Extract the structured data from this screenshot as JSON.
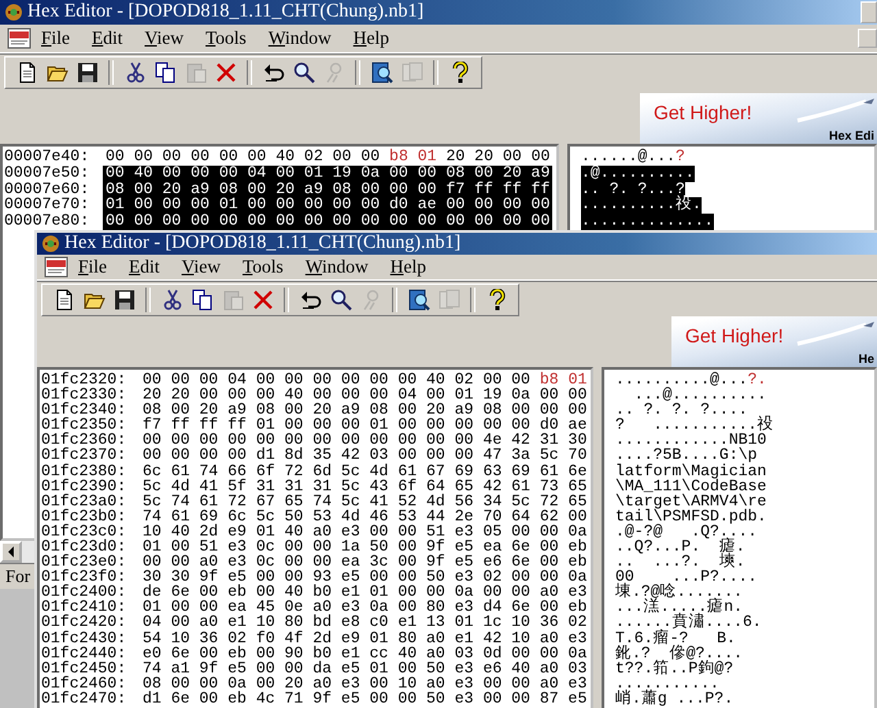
{
  "back_window": {
    "title": "Hex Editor - [DOPOD818_1.11_CHT(Chung).nb1]",
    "menu": [
      {
        "label": "File"
      },
      {
        "label": "Edit"
      },
      {
        "label": "View"
      },
      {
        "label": "Tools"
      },
      {
        "label": "Window"
      },
      {
        "label": "Help"
      }
    ],
    "toolbar": [
      {
        "kind": "new",
        "disabled": false
      },
      {
        "kind": "open",
        "disabled": false
      },
      {
        "kind": "save",
        "disabled": false
      },
      {
        "kind": "separator"
      },
      {
        "kind": "cut",
        "disabled": false
      },
      {
        "kind": "copy",
        "disabled": false
      },
      {
        "kind": "paste",
        "disabled": true
      },
      {
        "kind": "delete",
        "disabled": false
      },
      {
        "kind": "separator"
      },
      {
        "kind": "undo",
        "disabled": false
      },
      {
        "kind": "find",
        "disabled": false
      },
      {
        "kind": "replace",
        "disabled": true
      },
      {
        "kind": "separator"
      },
      {
        "kind": "find_doc",
        "disabled": false
      },
      {
        "kind": "docs",
        "disabled": true
      },
      {
        "kind": "separator"
      },
      {
        "kind": "help",
        "disabled": false
      }
    ],
    "banner": {
      "headline": "Get Higher!",
      "caption": "Hex Edi"
    },
    "rows": [
      {
        "offset": "00007e40:",
        "selected": false,
        "hex": [
          {
            "text": "00 00 00 00 00 00 40 02 00 00 ",
            "modified": false
          },
          {
            "text": "b8 01",
            "modified": true
          },
          {
            "text": " 20 20 00 00",
            "modified": false
          }
        ],
        "ascii": [
          {
            "text": "......@...",
            "modified": false
          },
          {
            "text": "?",
            "modified": true
          }
        ]
      },
      {
        "offset": "00007e50:",
        "selected": true,
        "hex": [
          {
            "text": "00 40 00 00 00 04 00 01 19 0a 00 00 08 00 20 a9",
            "modified": false
          }
        ],
        "ascii": [
          {
            "text": ".@..........",
            "modified": false
          }
        ]
      },
      {
        "offset": "00007e60:",
        "selected": true,
        "hex": [
          {
            "text": "08 00 20 a9 08 00 20 a9 08 00 00 00 f7 ff ff ff",
            "modified": false
          }
        ],
        "ascii": [
          {
            "text": ".. ?. ?...?",
            "modified": false
          }
        ]
      },
      {
        "offset": "00007e70:",
        "selected": true,
        "hex": [
          {
            "text": "01 00 00 00 01 00 00 00 00 00 d0 ae 00 00 00 00",
            "modified": false
          }
        ],
        "ascii": [
          {
            "text": "..........祋.",
            "modified": false
          }
        ]
      },
      {
        "offset": "00007e80:",
        "selected": true,
        "hex": [
          {
            "text": "00 00 00 00 00 00 00 00 00 00 00 00 00 00 00 00",
            "modified": false
          }
        ],
        "ascii": [
          {
            "text": "..............",
            "modified": false
          }
        ]
      }
    ],
    "status_bar": "For"
  },
  "front_window": {
    "title": "Hex Editor - [DOPOD818_1.11_CHT(Chung).nb1]",
    "menu": [
      {
        "label": "File"
      },
      {
        "label": "Edit"
      },
      {
        "label": "View"
      },
      {
        "label": "Tools"
      },
      {
        "label": "Window"
      },
      {
        "label": "Help"
      }
    ],
    "toolbar": [
      {
        "kind": "new",
        "disabled": false
      },
      {
        "kind": "open",
        "disabled": false
      },
      {
        "kind": "save",
        "disabled": false
      },
      {
        "kind": "separator"
      },
      {
        "kind": "cut",
        "disabled": false
      },
      {
        "kind": "copy",
        "disabled": false
      },
      {
        "kind": "paste",
        "disabled": true
      },
      {
        "kind": "delete",
        "disabled": false
      },
      {
        "kind": "separator"
      },
      {
        "kind": "undo",
        "disabled": false
      },
      {
        "kind": "find",
        "disabled": false
      },
      {
        "kind": "replace",
        "disabled": true
      },
      {
        "kind": "separator"
      },
      {
        "kind": "find_doc",
        "disabled": false
      },
      {
        "kind": "docs",
        "disabled": true
      },
      {
        "kind": "separator"
      },
      {
        "kind": "help",
        "disabled": false
      }
    ],
    "banner": {
      "headline": "Get Higher!",
      "caption": "He"
    },
    "rows": [
      {
        "offset": "01fc2320:",
        "selected": false,
        "hex": [
          {
            "text": "00 00 00 04 00 00 00 00 00 00 40 02 00 00 ",
            "modified": false
          },
          {
            "text": "b8 01",
            "modified": true
          }
        ],
        "ascii": [
          {
            "text": "..........@...",
            "modified": false
          },
          {
            "text": "?.",
            "modified": true
          }
        ]
      },
      {
        "offset": "01fc2330:",
        "selected": false,
        "hex": [
          {
            "text": "20 20 00 00 00 40 00 00 00 04 00 01 19 0a 00 00",
            "modified": false
          }
        ],
        "ascii": [
          {
            "text": "  ...@..........",
            "modified": false
          }
        ]
      },
      {
        "offset": "01fc2340:",
        "selected": false,
        "hex": [
          {
            "text": "08 00 20 a9 08 00 20 a9 08 00 20 a9 08 00 00 00",
            "modified": false
          }
        ],
        "ascii": [
          {
            "text": ".. ?. ?. ?....",
            "modified": false
          }
        ]
      },
      {
        "offset": "01fc2350:",
        "selected": false,
        "hex": [
          {
            "text": "f7 ff ff ff 01 00 00 00 01 00 00 00 00 00 d0 ae",
            "modified": false
          }
        ],
        "ascii": [
          {
            "text": "?   ...........祋",
            "modified": false
          }
        ]
      },
      {
        "offset": "01fc2360:",
        "selected": false,
        "hex": [
          {
            "text": "00 00 00 00 00 00 00 00 00 00 00 00 4e 42 31 30",
            "modified": false
          }
        ],
        "ascii": [
          {
            "text": "............NB10",
            "modified": false
          }
        ]
      },
      {
        "offset": "01fc2370:",
        "selected": false,
        "hex": [
          {
            "text": "00 00 00 00 d1 8d 35 42 03 00 00 00 47 3a 5c 70",
            "modified": false
          }
        ],
        "ascii": [
          {
            "text": "....?5B....G:\\p",
            "modified": false
          }
        ]
      },
      {
        "offset": "01fc2380:",
        "selected": false,
        "hex": [
          {
            "text": "6c 61 74 66 6f 72 6d 5c 4d 61 67 69 63 69 61 6e",
            "modified": false
          }
        ],
        "ascii": [
          {
            "text": "latform\\Magician",
            "modified": false
          }
        ]
      },
      {
        "offset": "01fc2390:",
        "selected": false,
        "hex": [
          {
            "text": "5c 4d 41 5f 31 31 31 5c 43 6f 64 65 42 61 73 65",
            "modified": false
          }
        ],
        "ascii": [
          {
            "text": "\\MA_111\\CodeBase",
            "modified": false
          }
        ]
      },
      {
        "offset": "01fc23a0:",
        "selected": false,
        "hex": [
          {
            "text": "5c 74 61 72 67 65 74 5c 41 52 4d 56 34 5c 72 65",
            "modified": false
          }
        ],
        "ascii": [
          {
            "text": "\\target\\ARMV4\\re",
            "modified": false
          }
        ]
      },
      {
        "offset": "01fc23b0:",
        "selected": false,
        "hex": [
          {
            "text": "74 61 69 6c 5c 50 53 4d 46 53 44 2e 70 64 62 00",
            "modified": false
          }
        ],
        "ascii": [
          {
            "text": "tail\\PSMFSD.pdb.",
            "modified": false
          }
        ]
      },
      {
        "offset": "01fc23c0:",
        "selected": false,
        "hex": [
          {
            "text": "10 40 2d e9 01 40 a0 e3 00 00 51 e3 05 00 00 0a",
            "modified": false
          }
        ],
        "ascii": [
          {
            "text": ".@-?@   .Q?....",
            "modified": false
          }
        ]
      },
      {
        "offset": "01fc23d0:",
        "selected": false,
        "hex": [
          {
            "text": "01 00 51 e3 0c 00 00 1a 50 00 9f e5 ea 6e 00 eb",
            "modified": false
          }
        ],
        "ascii": [
          {
            "text": "..Q?...P.  瘧.",
            "modified": false
          }
        ]
      },
      {
        "offset": "01fc23e0:",
        "selected": false,
        "hex": [
          {
            "text": "00 00 a0 e3 0c 00 00 ea 3c 00 9f e5 e6 6e 00 eb",
            "modified": false
          }
        ],
        "ascii": [
          {
            "text": "..  ...?.  塽.",
            "modified": false
          }
        ]
      },
      {
        "offset": "01fc23f0:",
        "selected": false,
        "hex": [
          {
            "text": "30 30 9f e5 00 00 93 e5 00 00 50 e3 02 00 00 0a",
            "modified": false
          }
        ],
        "ascii": [
          {
            "text": "00    ...P?....",
            "modified": false
          }
        ]
      },
      {
        "offset": "01fc2400:",
        "selected": false,
        "hex": [
          {
            "text": "de 6e 00 eb 00 40 b0 e1 01 00 00 0a 00 00 a0 e3",
            "modified": false
          }
        ],
        "ascii": [
          {
            "text": "埬.?@唸.......",
            "modified": false
          }
        ]
      },
      {
        "offset": "01fc2410:",
        "selected": false,
        "hex": [
          {
            "text": "01 00 00 ea 45 0e a0 e3 0a 00 80 e3 d4 6e 00 eb",
            "modified": false
          }
        ],
        "ascii": [
          {
            "text": "...溔.....瘧n.",
            "modified": false
          }
        ]
      },
      {
        "offset": "01fc2420:",
        "selected": false,
        "hex": [
          {
            "text": "04 00 a0 e1 10 80 bd e8 c0 e1 13 01 1c 10 36 02",
            "modified": false
          }
        ],
        "ascii": [
          {
            "text": "......賁潚....6.",
            "modified": false
          }
        ]
      },
      {
        "offset": "01fc2430:",
        "selected": false,
        "hex": [
          {
            "text": "54 10 36 02 f0 4f 2d e9 01 80 a0 e1 42 10 a0 e3",
            "modified": false
          }
        ],
        "ascii": [
          {
            "text": "T.6.瘤-?   B.",
            "modified": false
          }
        ]
      },
      {
        "offset": "01fc2440:",
        "selected": false,
        "hex": [
          {
            "text": "e0 6e 00 eb 00 90 b0 e1 cc 40 a0 03 0d 00 00 0a",
            "modified": false
          }
        ],
        "ascii": [
          {
            "text": "鈋.?  傪@?....",
            "modified": false
          }
        ]
      },
      {
        "offset": "01fc2450:",
        "selected": false,
        "hex": [
          {
            "text": "74 a1 9f e5 00 00 da e5 01 00 50 e3 e6 40 a0 03",
            "modified": false
          }
        ],
        "ascii": [
          {
            "text": "t??.筘..P鉤@?",
            "modified": false
          }
        ]
      },
      {
        "offset": "01fc2460:",
        "selected": false,
        "hex": [
          {
            "text": "08 00 00 0a 00 20 a0 e3 00 10 a0 e3 00 00 a0 e3",
            "modified": false
          }
        ],
        "ascii": [
          {
            "text": "...........",
            "modified": false
          }
        ]
      },
      {
        "offset": "01fc2470:",
        "selected": false,
        "hex": [
          {
            "text": "d1 6e 00 eb 4c 71 9f e5 00 00 50 e3 00 00 87 e5",
            "modified": false
          }
        ],
        "ascii": [
          {
            "text": "峭.蕭g ...P?.",
            "modified": false
          }
        ]
      }
    ]
  }
}
